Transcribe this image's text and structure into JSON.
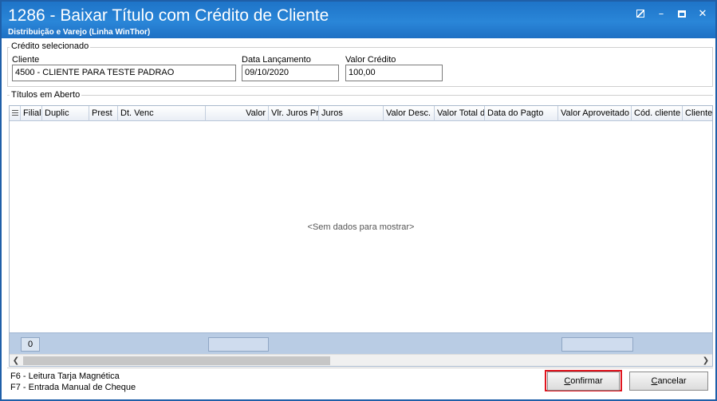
{
  "window": {
    "title": "1286 - Baixar Título com Crédito de Cliente",
    "subtitle": "Distribuição e Varejo (Linha WinThor)",
    "controls": [
      "edit-icon",
      "minimize-icon",
      "maximize-icon",
      "close-icon"
    ]
  },
  "credit_group": {
    "label": "Crédito selecionado",
    "client_label": "Cliente",
    "client_value": "4500 - CLIENTE PARA TESTE PADRAO",
    "date_label": "Data Lançamento",
    "date_value": "09/10/2020",
    "amount_label": "Valor Crédito",
    "amount_value": "100,00"
  },
  "titles_group": {
    "label": "Títulos em Aberto"
  },
  "grid": {
    "columns": [
      "Filial",
      "Duplic",
      "Prest",
      "Dt. Venc",
      "Valor",
      "Vlr. Juros Pr",
      "Juros",
      "Valor Desc.",
      "Valor Total d",
      "Data do Pagto",
      "Valor Aproveitado",
      "Cód. cliente",
      "Cliente"
    ],
    "empty_message": "<Sem dados para mostrar>",
    "row_count": "0"
  },
  "hints": {
    "f6": "F6 - Leitura Tarja Magnética",
    "f7": "F7 - Entrada Manual de Cheque"
  },
  "buttons": {
    "confirm_mnemonic": "C",
    "confirm_rest": "onfirmar",
    "cancel_mnemonic": "C",
    "cancel_rest": "ancelar"
  },
  "colors": {
    "titlebar": "#1e74c8",
    "highlight": "#e0141e",
    "grid_footer": "#b9cce4"
  }
}
